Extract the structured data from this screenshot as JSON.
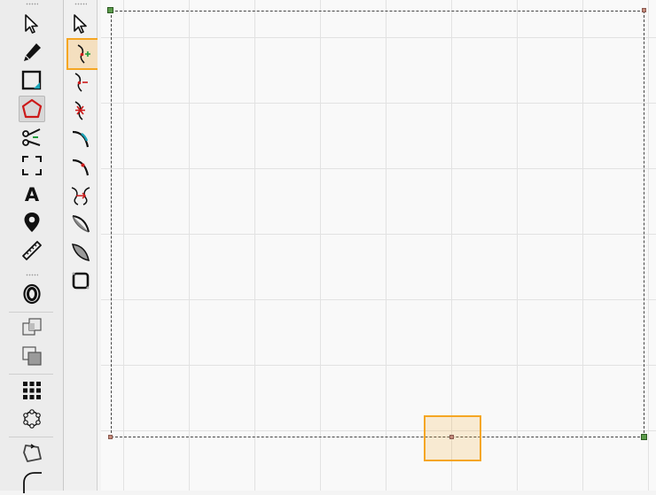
{
  "left_toolbar": {
    "tools": [
      {
        "icon": "select-arrow-icon"
      },
      {
        "icon": "pen-icon"
      },
      {
        "icon": "rectangle-icon"
      },
      {
        "icon": "polygon-icon"
      },
      {
        "icon": "scissors-icon"
      },
      {
        "icon": "crop-corners-icon"
      },
      {
        "icon": "text-icon",
        "label": "A"
      },
      {
        "icon": "map-pin-icon"
      },
      {
        "icon": "ruler-icon"
      },
      {
        "icon": "ring-icon",
        "label": "O"
      },
      {
        "icon": "union-icon"
      },
      {
        "icon": "subtract-icon"
      },
      {
        "icon": "grid-dots-icon"
      },
      {
        "icon": "circle-nodes-icon"
      },
      {
        "icon": "polyline-icon"
      },
      {
        "icon": "rounded-corner-icon"
      }
    ],
    "active_tool": "polygon-icon"
  },
  "sub_toolbar": {
    "tools": [
      {
        "icon": "node-select-icon"
      },
      {
        "icon": "add-node-icon"
      },
      {
        "icon": "remove-node-icon"
      },
      {
        "icon": "break-node-icon"
      },
      {
        "icon": "curve-segment-icon"
      },
      {
        "icon": "line-segment-icon"
      },
      {
        "icon": "join-nodes-icon"
      },
      {
        "icon": "smooth-path-icon"
      },
      {
        "icon": "cusp-path-icon"
      },
      {
        "icon": "rounded-square-icon"
      }
    ],
    "active_tool": "add-node-icon"
  },
  "colors": {
    "accent_orange": "#f5a623",
    "polygon_red": "#cc1a1a",
    "handle_green": "#5a9a4a"
  }
}
